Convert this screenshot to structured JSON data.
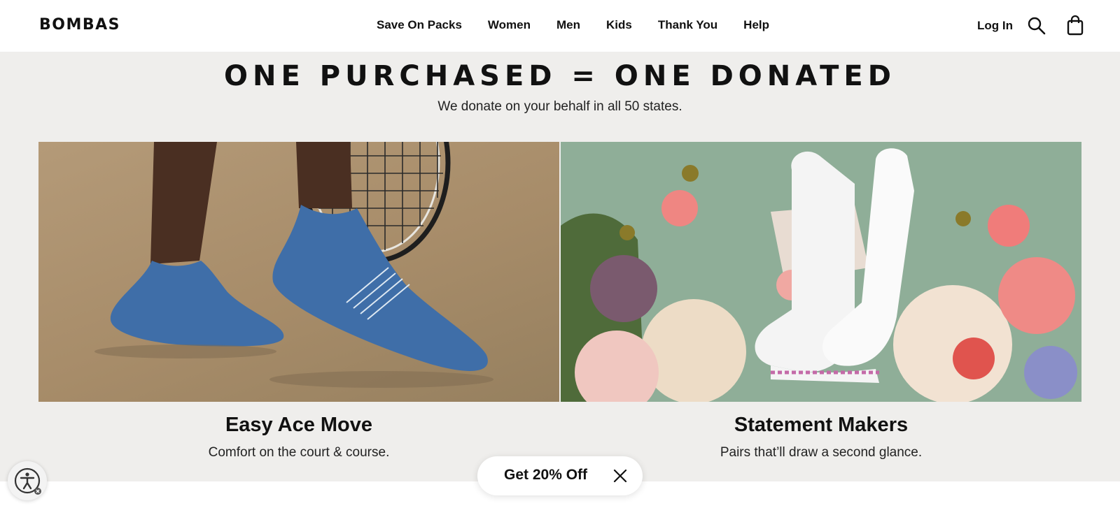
{
  "header": {
    "logo": "BOMBAS",
    "nav": [
      "Save On Packs",
      "Women",
      "Men",
      "Kids",
      "Thank You",
      "Help"
    ],
    "login": "Log In",
    "icons": {
      "search": "search-icon",
      "cart": "shopping-bag-icon"
    }
  },
  "hero": {
    "title": "ONE PURCHASED = ONE DONATED",
    "subtitle": "We donate on your behalf in all 50 states."
  },
  "cards": [
    {
      "title": "Easy Ace Move",
      "subtitle": "Comfort on the court & course.",
      "image": "blue ankle socks with tennis racket"
    },
    {
      "title": "Statement Makers",
      "subtitle": "Pairs that’ll draw a second glance.",
      "image": "white socks among flowers"
    }
  ],
  "promo": {
    "label": "Get 20% Off",
    "close_icon": "close-icon"
  },
  "accessibility": {
    "icon": "accessibility-icon"
  },
  "colors": {
    "page_bg": "#efeeec",
    "header_bg": "#ffffff",
    "text": "#111111",
    "sock_blue": "#3f6ea8",
    "card_green": "#8fae98"
  }
}
